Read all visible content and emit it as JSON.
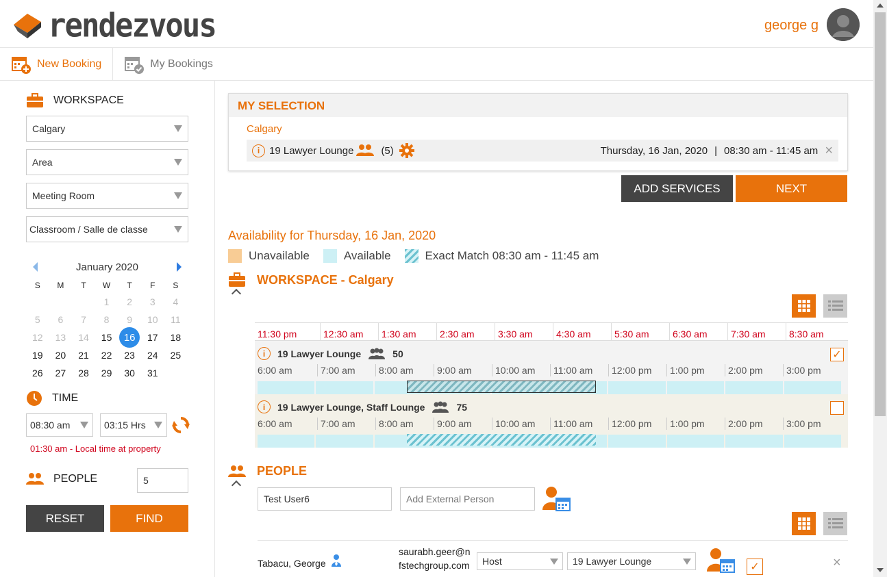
{
  "app": {
    "logo_text": "rendezvous",
    "user_name": "george g"
  },
  "tabs": [
    {
      "label": "New Booking",
      "icon": "calendar-add-icon"
    },
    {
      "label": "My Bookings",
      "icon": "calendar-check-icon"
    }
  ],
  "sidebar": {
    "workspace_label": "WORKSPACE",
    "filters": {
      "city": "Calgary",
      "area": "Area",
      "room_type": "Meeting Room",
      "layout": "Classroom / Salle de classe"
    },
    "calendar": {
      "month": "January 2020",
      "days_of_week": [
        "S",
        "M",
        "T",
        "W",
        "T",
        "F",
        "S"
      ],
      "selected_day": "16"
    },
    "time_label": "TIME",
    "start_time": "08:30 am",
    "duration": "03:15 Hrs",
    "local_time_note": "01:30 am - Local time at property",
    "people_label": "PEOPLE",
    "people_count": "5",
    "reset_label": "RESET",
    "find_label": "FIND"
  },
  "selection": {
    "title": "MY SELECTION",
    "city": "Calgary",
    "room": "19 Lawyer Lounge",
    "people": "(5)",
    "date": "Thursday, 16 Jan, 2020",
    "separator": "|",
    "time_range": "08:30 am - 11:45 am",
    "close_glyph": "×"
  },
  "actions": {
    "add_services": "ADD SERVICES",
    "next": "NEXT"
  },
  "availability": {
    "title": "Availability for Thursday, 16 Jan, 2020",
    "legend": {
      "unavailable": "Unavailable",
      "available": "Available",
      "exact": "Exact Match 08:30 am - 11:45 am"
    },
    "colors": {
      "unavailable": "#f8cc95",
      "available": "#cdf0f5",
      "accent": "#e8720c"
    }
  },
  "workspace_section": {
    "title": "WORKSPACE - Calgary",
    "axis_times": [
      "11:30 pm",
      "12:30 am",
      "1:30 am",
      "2:30 am",
      "3:30 am",
      "4:30 am",
      "5:30 am",
      "6:30 am",
      "7:30 am",
      "8:30 am"
    ],
    "local_times": [
      "6:00 am",
      "7:00 am",
      "8:00 am",
      "9:00 am",
      "10:00 am",
      "11:00 am",
      "12:00 pm",
      "1:00 pm",
      "2:00 pm",
      "3:00 pm"
    ],
    "rooms": [
      {
        "name": "19 Lawyer Lounge",
        "capacity": "50",
        "checked": true,
        "check_glyph": "✓"
      },
      {
        "name": "19 Lawyer Lounge, Staff Lounge",
        "capacity": "75",
        "checked": false
      }
    ]
  },
  "people_section": {
    "title": "PEOPLE",
    "internal_person_value": "Test User6",
    "external_placeholder": "Add External Person",
    "attendee": {
      "name": "Tabacu, George",
      "email": "saurabh.geer@nfstechgroup.com",
      "role": "Host",
      "room": "19 Lawyer Lounge",
      "check_glyph": "✓",
      "remove_glyph": "×"
    }
  },
  "info_glyph": "i"
}
